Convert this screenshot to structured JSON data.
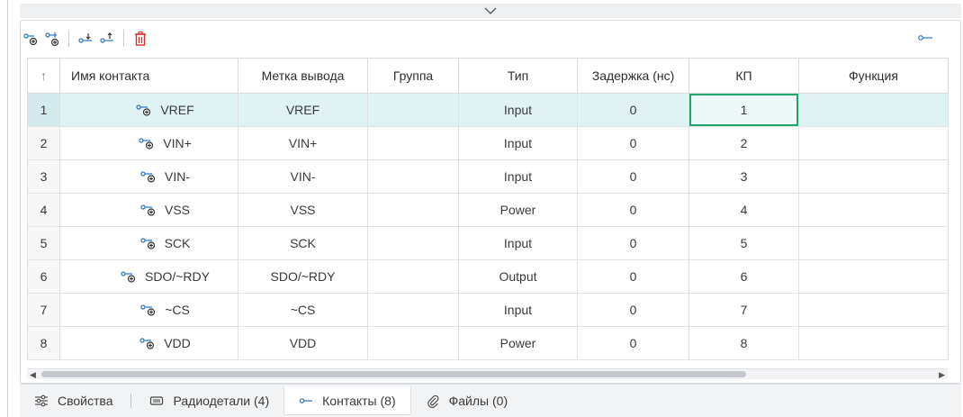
{
  "toolbar": {
    "buttons": [
      {
        "icon": "add-pin-icon"
      },
      {
        "icon": "add-pin-group-icon"
      },
      {
        "icon": "move-pin-down-icon"
      },
      {
        "icon": "move-pin-up-icon"
      },
      {
        "icon": "delete-icon",
        "color": "#d0342c"
      }
    ],
    "right_icon": "pin-view-icon"
  },
  "table": {
    "sort_indicator": "↑",
    "columns": [
      "Имя контакта",
      "Метка вывода",
      "Группа",
      "Тип",
      "Задержка (нс)",
      "КП",
      "Функция"
    ],
    "rows": [
      {
        "num": "1",
        "name": "VREF",
        "label": "VREF",
        "group": "",
        "type": "Input",
        "delay": "0",
        "kp": "1",
        "func": ""
      },
      {
        "num": "2",
        "name": "VIN+",
        "label": "VIN+",
        "group": "",
        "type": "Input",
        "delay": "0",
        "kp": "2",
        "func": ""
      },
      {
        "num": "3",
        "name": "VIN-",
        "label": "VIN-",
        "group": "",
        "type": "Input",
        "delay": "0",
        "kp": "3",
        "func": ""
      },
      {
        "num": "4",
        "name": "VSS",
        "label": "VSS",
        "group": "",
        "type": "Power",
        "delay": "0",
        "kp": "4",
        "func": ""
      },
      {
        "num": "5",
        "name": "SCK",
        "label": "SCK",
        "group": "",
        "type": "Input",
        "delay": "0",
        "kp": "5",
        "func": ""
      },
      {
        "num": "6",
        "name": "SDO/~RDY",
        "label": "SDO/~RDY",
        "group": "",
        "type": "Output",
        "delay": "0",
        "kp": "6",
        "func": ""
      },
      {
        "num": "7",
        "name": "~CS",
        "label": "~CS",
        "group": "",
        "type": "Input",
        "delay": "0",
        "kp": "7",
        "func": ""
      },
      {
        "num": "8",
        "name": "VDD",
        "label": "VDD",
        "group": "",
        "type": "Power",
        "delay": "0",
        "kp": "8",
        "func": ""
      }
    ],
    "selected_row": "1"
  },
  "tabs": [
    {
      "label": "Свойства",
      "icon": "properties-sliders-icon"
    },
    {
      "label": "Радиодетали (4)",
      "icon": "component-chip-icon"
    },
    {
      "label": "Контакты (8)",
      "icon": "pin-icon"
    },
    {
      "label": "Файлы (0)",
      "icon": "paperclip-icon"
    }
  ],
  "colors": {
    "accent_green": "#21a56b",
    "selection": "#dff2f4",
    "delete": "#d0342c"
  }
}
